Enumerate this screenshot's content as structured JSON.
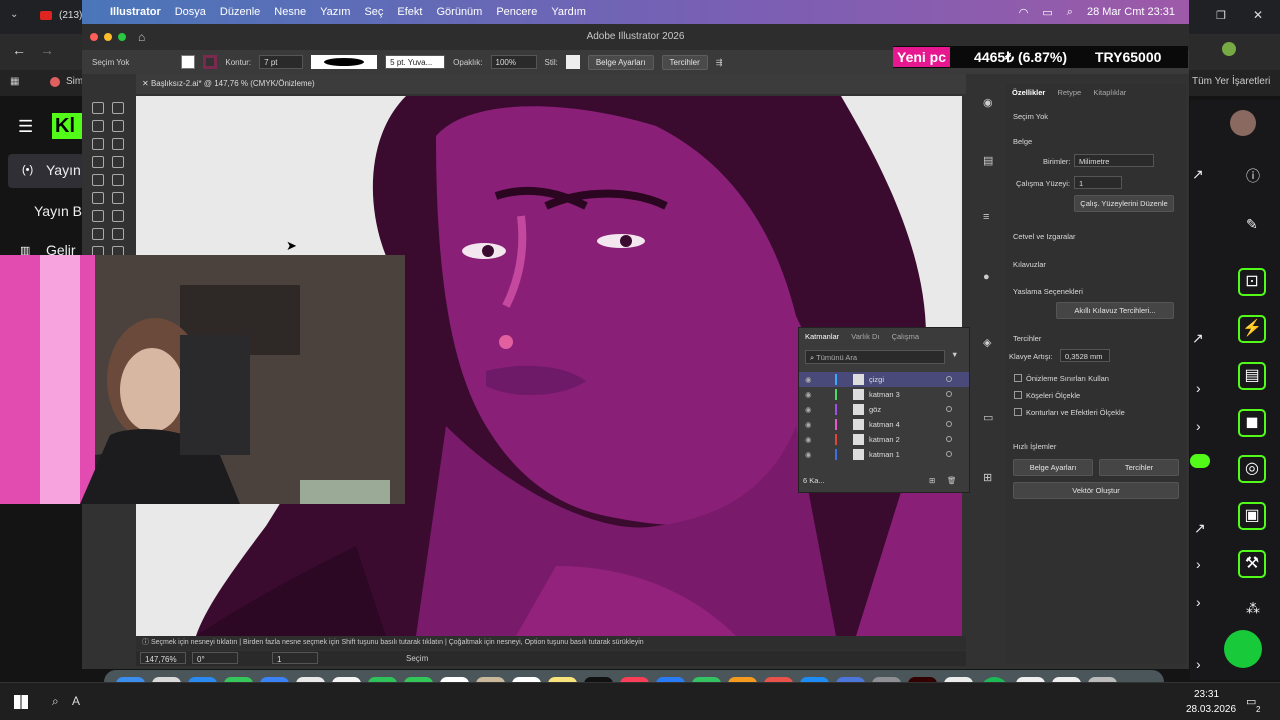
{
  "browser": {
    "tab_count": "(213)",
    "bookmark": "Sim",
    "all_bookmarks": "Tüm Yer İşaretleri"
  },
  "twitch": {
    "nav_items": [
      "Yayın",
      "Yayın B",
      "Gelir"
    ],
    "logo": "Kl"
  },
  "menubar": {
    "app": "Illustrator",
    "items": [
      "Dosya",
      "Düzenle",
      "Nesne",
      "Yazım",
      "Seç",
      "Efekt",
      "Görünüm",
      "Pencere",
      "Yardım"
    ],
    "datetime": "28 Mar Cmt  23:31"
  },
  "window": {
    "title": "Adobe Illustrator 2026"
  },
  "control": {
    "selection": "Seçim Yok",
    "stroke_label": "Kontur:",
    "stroke_value": "7 pt",
    "brush": "5 pt. Yuva...",
    "opacity_label": "Opaklık:",
    "opacity_value": "100%",
    "style_label": "Stil:",
    "doc_settings": "Belge Ayarları",
    "prefs": "Tercihler"
  },
  "doc_tab": {
    "name": "Başlıksız-2.ai* @ 147,76 % (CMYK/Önizleme)"
  },
  "status": {
    "hint": "Seçmek için nesneyi tıklatın  |  Birden fazla nesne seçmek için Shift tuşunu basılı tutarak tıklatın  |  Çoğaltmak için nesneyi, Option tuşunu basılı tutarak sürükleyin",
    "zoom": "147,76%",
    "angle": "0°",
    "artboard": "1",
    "mode": "Seçim"
  },
  "properties": {
    "tabs": [
      "Özellikler",
      "Retype",
      "Kitaplıklar"
    ],
    "no_selection": "Seçim Yok",
    "doc_heading": "Belge",
    "units_label": "Birimler:",
    "units_value": "Milimetre",
    "artboard_label": "Çalışma Yüzeyi:",
    "artboard_value": "1",
    "edit_artboards": "Çalış. Yüzeylerini Düzenle",
    "rulers_grids": "Cetvel ve Izgaralar",
    "guides": "Kılavuzlar",
    "snap": "Yaslama Seçenekleri",
    "smart_guides": "Akıllı Kılavuz Tercihleri...",
    "prefs_heading": "Tercihler",
    "key_inc_label": "Klavye Artışı:",
    "key_inc_value": "0,3528 mm",
    "check1": "Önizleme Sınırları Kullan",
    "check2": "Köşeleri Ölçekle",
    "check3": "Konturları ve Efektleri Ölçekle",
    "quick_actions": "Hızlı İşlemler",
    "btn_doc": "Belge Ayarları",
    "btn_prefs": "Tercihler",
    "btn_vector": "Vektör Oluştur"
  },
  "layers": {
    "tabs": [
      "Katmanlar",
      "Varlık Dı",
      "Çalışma"
    ],
    "search_placeholder": "Tümünü Ara",
    "items": [
      {
        "name": "çizgi",
        "color": "#3aa8ff"
      },
      {
        "name": "katman 3",
        "color": "#4cd964"
      },
      {
        "name": "göz",
        "color": "#a34fe3"
      },
      {
        "name": "katman 4",
        "color": "#e858c6"
      },
      {
        "name": "katman 2",
        "color": "#e0443a"
      },
      {
        "name": "katman 1",
        "color": "#3d6ee6"
      }
    ],
    "count": "6 Ka..."
  },
  "ticker": {
    "label": "Yeni pc",
    "value": "4465₺ (6.87%)",
    "goal": "TRY65000"
  },
  "dock": {
    "calendar_day": "28"
  },
  "taskbar": {
    "time": "23:31",
    "date": "28.03.2026",
    "search": "A",
    "notif": "2"
  }
}
